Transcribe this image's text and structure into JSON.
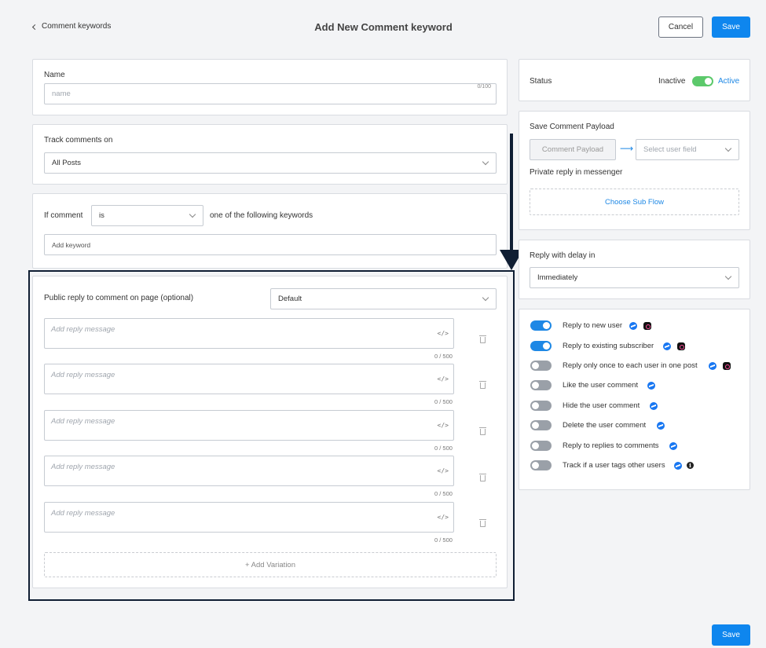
{
  "header": {
    "back_label": "Comment keywords",
    "title": "Add New Comment keyword",
    "cancel_label": "Cancel",
    "save_label": "Save"
  },
  "name_card": {
    "label": "Name",
    "placeholder": "name",
    "counter": "0/100"
  },
  "track_card": {
    "label": "Track comments on",
    "value": "All Posts"
  },
  "condition_card": {
    "prefix": "If comment",
    "operator": "is",
    "suffix": "one of the following keywords",
    "keyword_placeholder": "Add keyword"
  },
  "public_reply_card": {
    "label": "Public reply to comment on page (optional)",
    "select_value": "Default",
    "replies": [
      {
        "placeholder": "Add reply message",
        "code_icon": "</>",
        "counter": "0 / 500"
      },
      {
        "placeholder": "Add reply message",
        "code_icon": "</>",
        "counter": "0 / 500"
      },
      {
        "placeholder": "Add reply message",
        "code_icon": "</>",
        "counter": "0 / 500"
      },
      {
        "placeholder": "Add reply message",
        "code_icon": "</>",
        "counter": "0 / 500"
      },
      {
        "placeholder": "Add reply message",
        "code_icon": "</>",
        "counter": "0 / 500"
      }
    ],
    "add_variation_label": "+ Add Variation"
  },
  "status_card": {
    "label": "Status",
    "inactive_label": "Inactive",
    "active_label": "Active"
  },
  "payload_card": {
    "label": "Save Comment Payload",
    "payload_field": "Comment Payload",
    "arrow": "⟶",
    "select_placeholder": "Select user field",
    "private_reply_label": "Private reply in messenger",
    "choose_subflow_label": "Choose Sub Flow"
  },
  "delay_card": {
    "label": "Reply with delay in",
    "value": "Immediately"
  },
  "options_card": {
    "items": [
      {
        "label": "Reply to new user",
        "on": true,
        "icons": [
          "messenger-icon",
          "instagram-icon"
        ]
      },
      {
        "label": "Reply to existing subscriber",
        "on": true,
        "icons": [
          "messenger-icon",
          "instagram-icon"
        ]
      },
      {
        "label": "Reply only once to each user in one post",
        "on": false,
        "icons": [
          "messenger-icon",
          "instagram-icon"
        ]
      },
      {
        "label": "Like the user comment",
        "on": false,
        "icons": [
          "messenger-icon"
        ]
      },
      {
        "label": "Hide the user comment",
        "on": false,
        "icons": [
          "messenger-icon"
        ]
      },
      {
        "label": "Delete the user comment",
        "on": false,
        "icons": [
          "messenger-icon"
        ]
      },
      {
        "label": "Reply to replies to comments",
        "on": false,
        "icons": [
          "messenger-icon"
        ]
      },
      {
        "label": "Track if a user tags other users",
        "on": false,
        "icons": [
          "messenger-icon",
          "info-icon"
        ],
        "info_glyph": "i"
      }
    ]
  },
  "footer": {
    "save_label": "Save"
  },
  "colors": {
    "primary": "#0e86ee",
    "toggle_on": "#1e88e5",
    "toggle_off": "#9aa0a8",
    "status_active": "#5cc96b",
    "highlight_border": "#0f1e33"
  }
}
